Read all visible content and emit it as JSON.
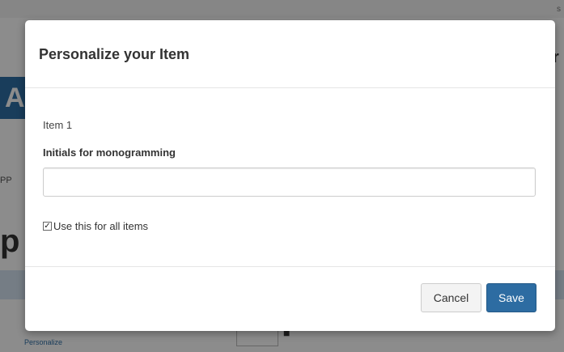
{
  "background": {
    "topbar_text": "s",
    "brand_letter": "A",
    "right_glyph": "r",
    "crumb_text": "PP",
    "heading_text": "p",
    "link_text": "Personalize",
    "dot": "■"
  },
  "modal": {
    "title": "Personalize your Item",
    "item_label": "Item 1",
    "field_label": "Initials for monogramming",
    "input_value": "",
    "input_placeholder": "",
    "checkbox_checked": true,
    "checkbox_mark": "✓",
    "checkbox_label": "Use this for all items",
    "cancel_label": "Cancel",
    "save_label": "Save"
  },
  "colors": {
    "primary": "#2d6ca2",
    "overlay": "#000000"
  }
}
